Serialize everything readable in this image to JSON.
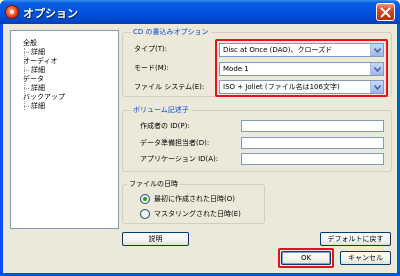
{
  "window": {
    "title": "オプション",
    "app_icon": "disc-burner-icon",
    "close_icon": "close-icon"
  },
  "tree": {
    "items": [
      {
        "label": "全般",
        "level": 0
      },
      {
        "label": "詳細",
        "level": 1
      },
      {
        "label": "オーディオ",
        "level": 0
      },
      {
        "label": "詳細",
        "level": 1
      },
      {
        "label": "データ",
        "level": 0
      },
      {
        "label": "詳細",
        "level": 1,
        "selected": true
      },
      {
        "label": "バックアップ",
        "level": 0
      },
      {
        "label": "詳細",
        "level": 1
      }
    ]
  },
  "cd_write": {
    "group_label": "CD の書込みオプション",
    "type_label": "タイプ(T):",
    "type_value": "Disc at Once (DAO)、クローズド",
    "mode_label": "モード(M):",
    "mode_value": "Mode 1",
    "fs_label": "ファイル システム(E):",
    "fs_value": "ISO + Joliet (ファイル名は106文字)"
  },
  "volume": {
    "group_label": "ボリューム記述子",
    "author_label": "作成者の ID(P):",
    "author_value": "",
    "preparer_label": "データ準備担当者(D):",
    "preparer_value": "",
    "app_label": "アプリケーション ID(A):",
    "app_value": ""
  },
  "file_date": {
    "group_label": "ファイルの日時",
    "option1": "最初に作成された日時(O)",
    "option2": "マスタリングされた日時(E)",
    "selected": "option1"
  },
  "buttons": {
    "help": "説明",
    "defaults": "デフォルトに戻す",
    "ok": "OK",
    "cancel": "キャンセル"
  },
  "colors": {
    "highlight": "#e3131e",
    "titlebar": "#0054e3",
    "dialog_bg": "#ece9d8"
  }
}
